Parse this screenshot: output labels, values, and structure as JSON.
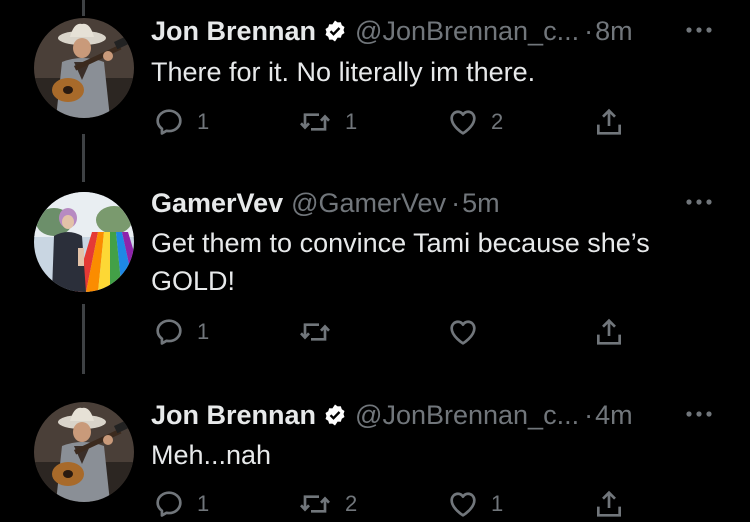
{
  "colors": {
    "background": "#000000",
    "text": "#e7e9ea",
    "secondary": "#71767b",
    "thread_line": "#3e4144"
  },
  "tweets": [
    {
      "name": "Jon Brennan",
      "verified": true,
      "handle": "@JonBrennan_c...",
      "separator": "·",
      "time": "8m",
      "text": "There for it. No literally im there.",
      "replies": "1",
      "retweets": "1",
      "likes": "2",
      "avatar_icon": "cowboy-guitarist-avatar"
    },
    {
      "name": "GamerVev",
      "verified": false,
      "handle": "@GamerVev",
      "separator": "·",
      "time": "5m",
      "text": "Get them to convince Tami because she’s GOLD!",
      "replies": "1",
      "retweets": "",
      "likes": "",
      "avatar_icon": "rainbow-crosswalk-avatar"
    },
    {
      "name": "Jon Brennan",
      "verified": true,
      "handle": "@JonBrennan_c...",
      "separator": "·",
      "time": "4m",
      "text": "Meh...nah",
      "replies": "1",
      "retweets": "2",
      "likes": "1",
      "avatar_icon": "cowboy-guitarist-avatar"
    }
  ],
  "icons": {
    "reply": "reply-icon",
    "retweet": "retweet-icon",
    "like": "heart-icon",
    "share": "share-icon",
    "more": "more-options-icon",
    "verified": "verified-badge-icon"
  }
}
